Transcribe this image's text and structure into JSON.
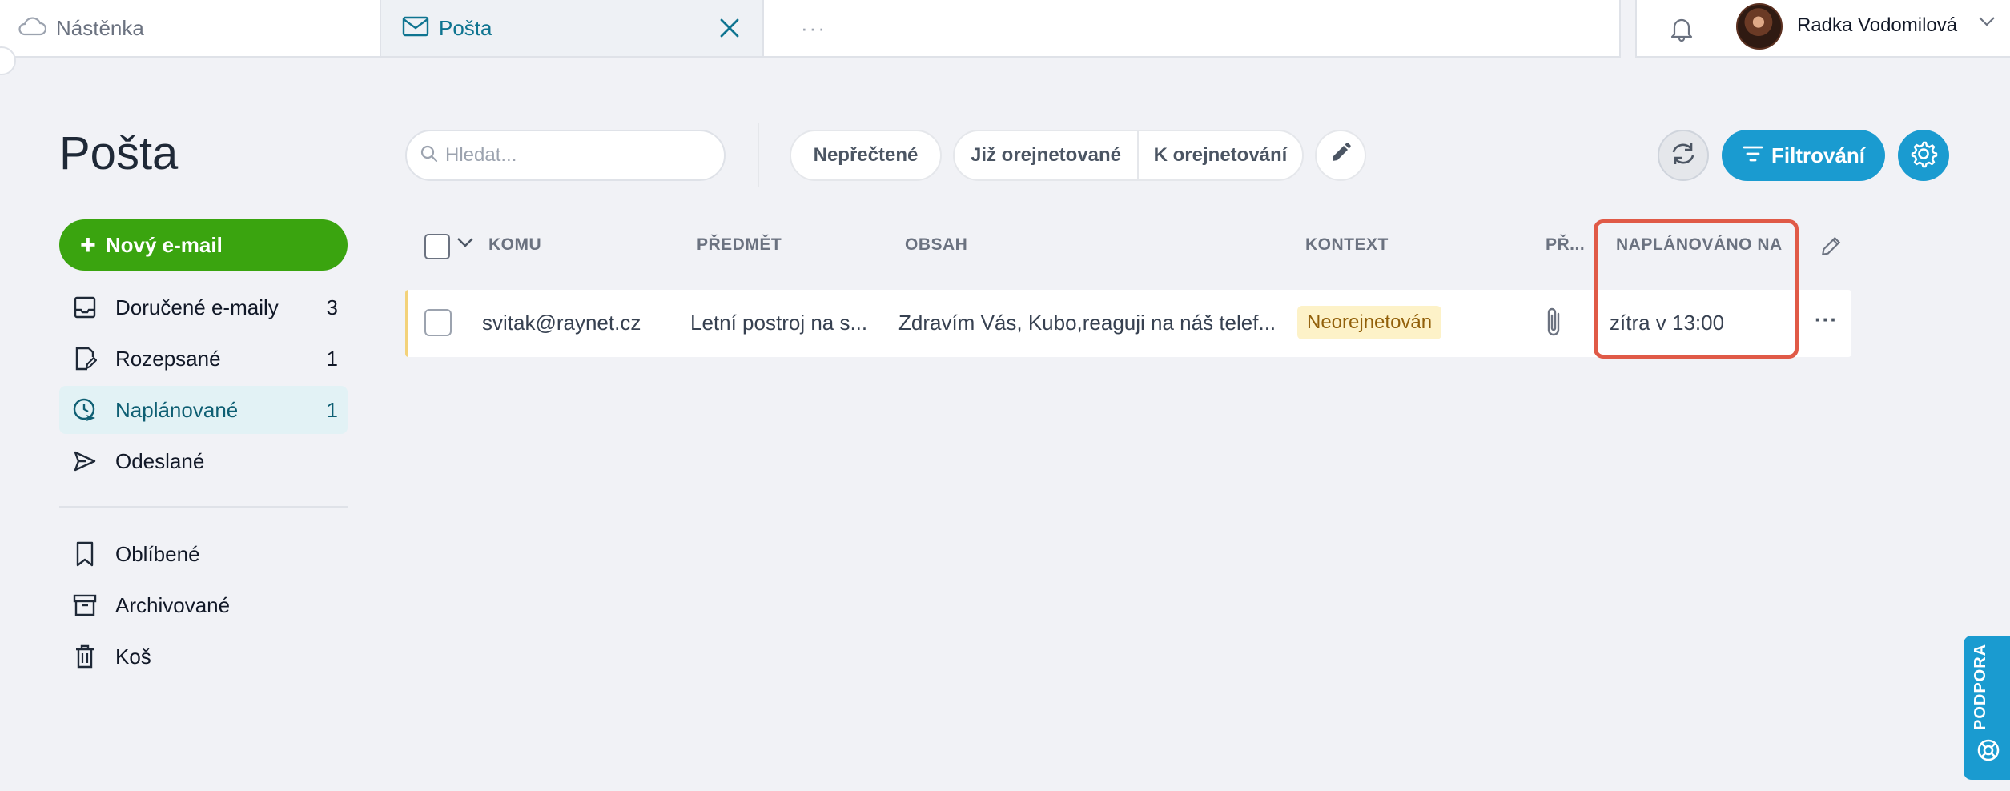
{
  "tabs": {
    "dashboard": "Nástěnka",
    "mail": "Pošta",
    "more": "···"
  },
  "user": {
    "name": "Radka Vodomilová"
  },
  "page": {
    "title": "Pošta"
  },
  "actions": {
    "new_mail": "Nový e-mail"
  },
  "sidebar": {
    "items": [
      {
        "label": "Doručené e-maily",
        "count": "3",
        "icon": "inbox-icon"
      },
      {
        "label": "Rozepsané",
        "count": "1",
        "icon": "draft-icon"
      },
      {
        "label": "Naplánované",
        "count": "1",
        "icon": "scheduled-icon",
        "active": true
      },
      {
        "label": "Odeslané",
        "count": "",
        "icon": "send-icon"
      },
      {
        "label": "Oblíbené",
        "count": "",
        "icon": "bookmark-icon"
      },
      {
        "label": "Archivované",
        "count": "",
        "icon": "archive-icon"
      },
      {
        "label": "Koš",
        "count": "",
        "icon": "trash-icon"
      }
    ]
  },
  "toolbar": {
    "search_placeholder": "Hledat...",
    "unread": "Nepřečtené",
    "already_oriented": "Již orejnetované",
    "to_orient": "K orejnetování",
    "filter": "Filtrování"
  },
  "table": {
    "headers": {
      "to": "KOMU",
      "subject": "PŘEDMĚT",
      "content": "OBSAH",
      "context": "KONTEXT",
      "attachments": "PŘ...",
      "scheduled": "NAPLÁNOVÁNO NA"
    },
    "rows": [
      {
        "to": "svitak@raynet.cz",
        "subject": "Letní postroj na s...",
        "content": "Zdravím Vás, Kubo,reaguji na náš telef...",
        "context": "Neorejnetován",
        "scheduled": "zítra v 13:00"
      }
    ]
  },
  "support": {
    "label": "PODPORA"
  },
  "colors": {
    "accent": "#1a9bd0",
    "primary_green": "#3aa40f",
    "highlight": "#e05a47",
    "tag_bg": "#fdf2c8"
  }
}
